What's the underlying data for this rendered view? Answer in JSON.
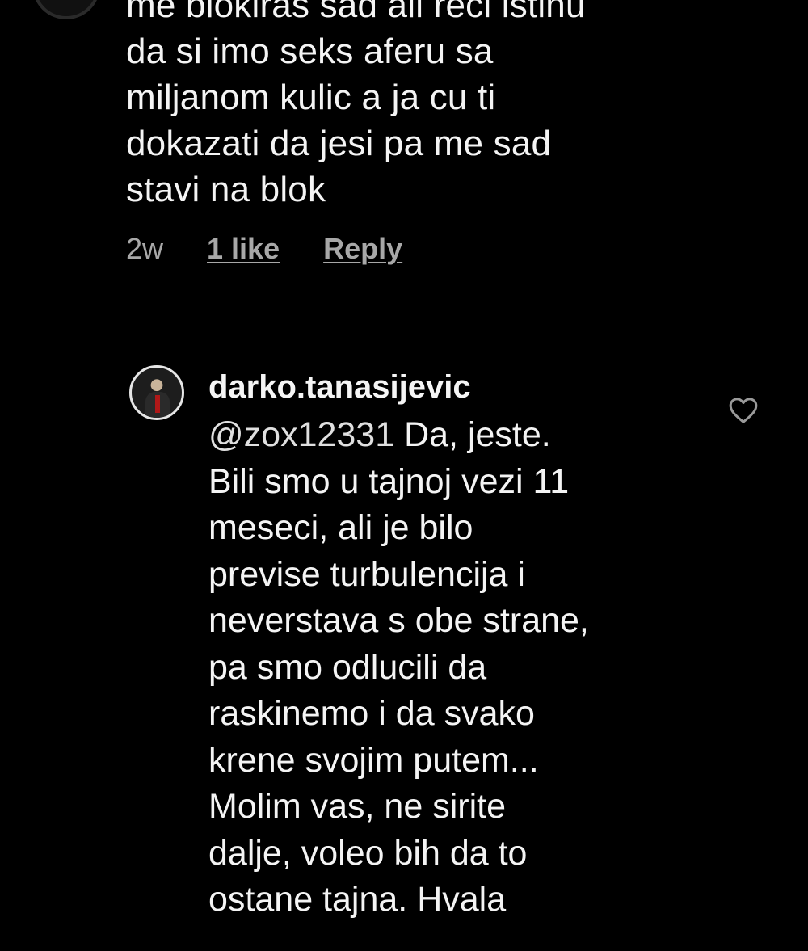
{
  "comment": {
    "text": "me blokiras sad ali reci istinu\nda si imo seks aferu sa\nmiljanom kulic a ja cu ti\ndokazati da jesi pa me sad\nstavi na blok",
    "time": "2w",
    "likes_label": "1 like",
    "reply_label": "Reply"
  },
  "reply": {
    "username": "darko.tanasijevic",
    "mention": "@zox12331",
    "text_lines": [
      " Da, jeste.",
      "Bili smo u tajnoj vezi 11",
      "meseci, ali je bilo",
      "previse turbulencija i",
      "neverstava s obe strane,",
      "pa smo odlucili da",
      "raskinemo i da svako",
      "krene svojim putem...",
      "Molim vas, ne sirite",
      "dalje, voleo bih da to",
      "ostane tajna. Hvala"
    ],
    "like_icon": "heart-outline-icon"
  },
  "colors": {
    "background": "#000000",
    "text": "#f4f4f4",
    "secondary": "#a8a8a8"
  }
}
